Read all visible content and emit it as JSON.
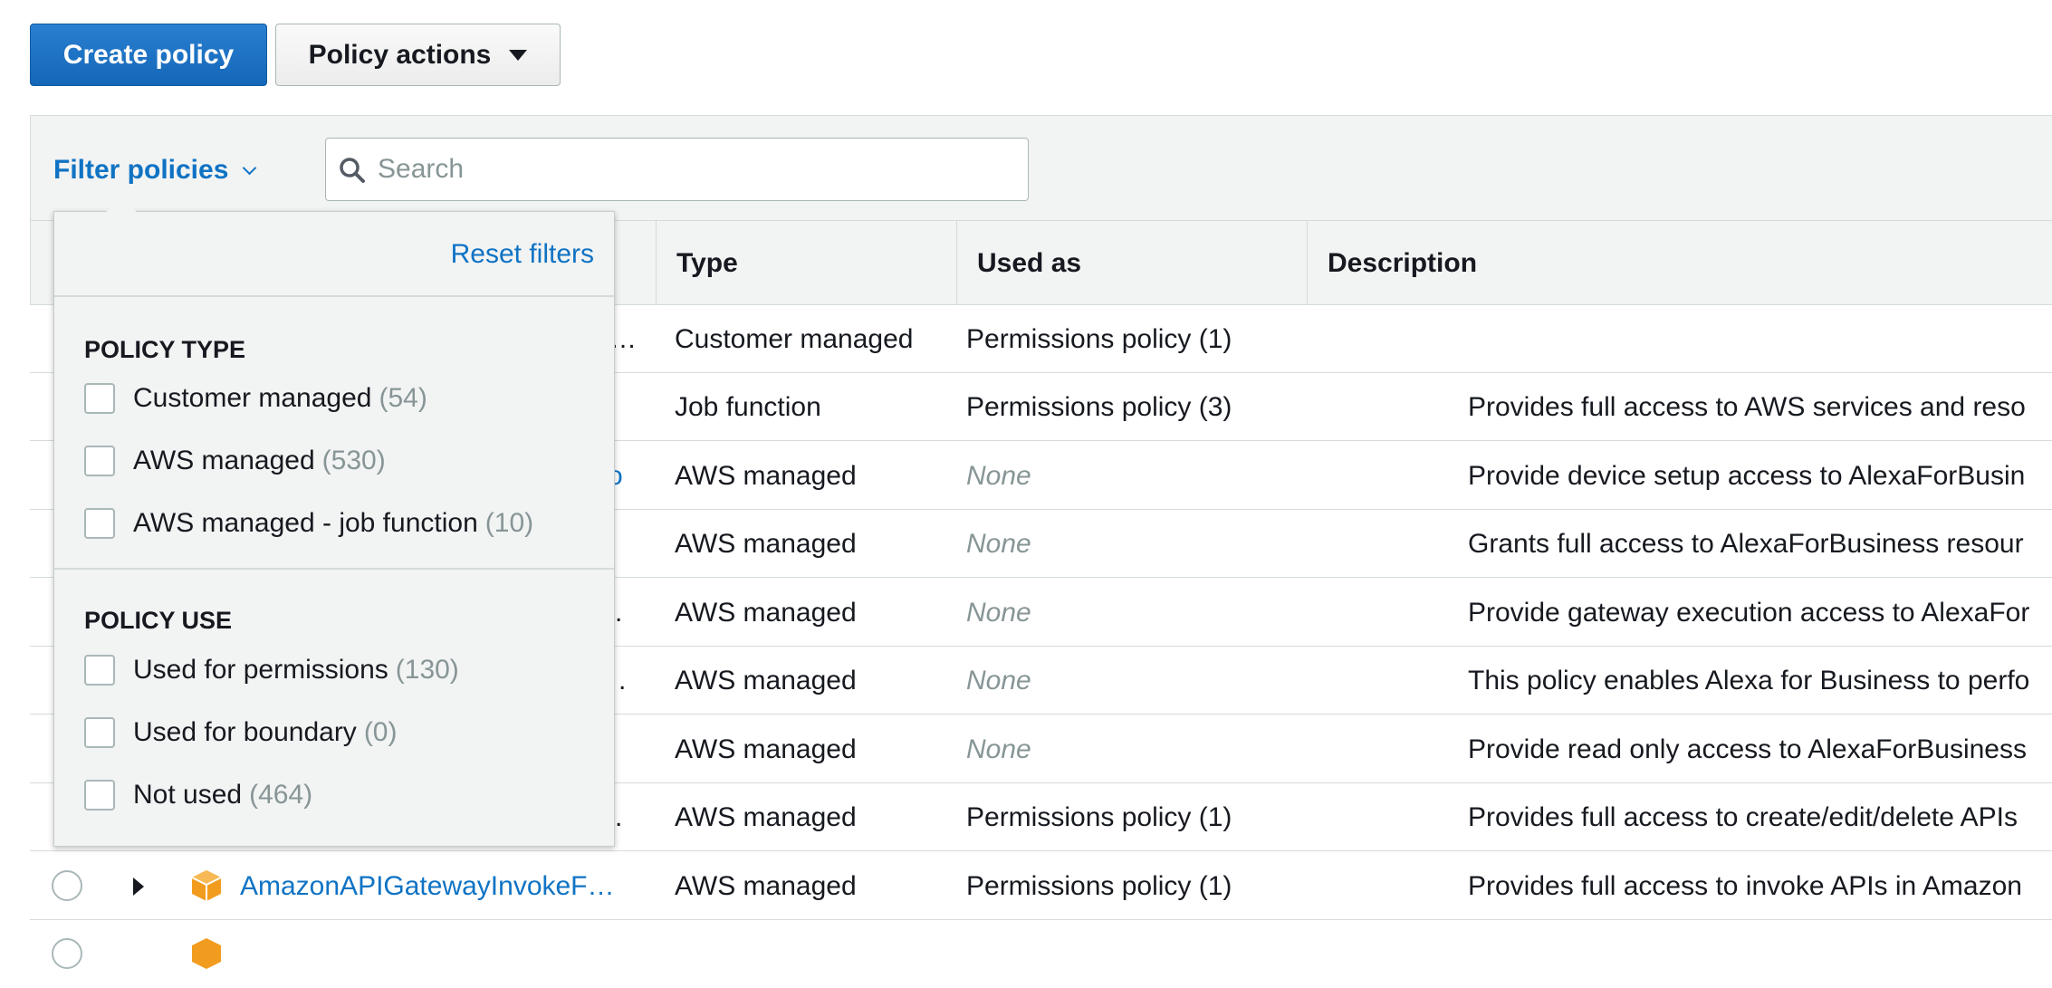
{
  "toolbar": {
    "create_label": "Create policy",
    "actions_label": "Policy actions"
  },
  "filter": {
    "toggle_label": "Filter policies",
    "search_placeholder": "Search"
  },
  "columns": [
    "Type",
    "Used as",
    "Description"
  ],
  "rows": [
    {
      "name_tail": "…",
      "type": "Customer managed",
      "used_as": "Permissions policy (1)",
      "used_none": false,
      "description": ""
    },
    {
      "name_tail": "",
      "type": "Job function",
      "used_as": "Permissions policy (3)",
      "used_none": false,
      "description": "Provides full access to AWS services and reso"
    },
    {
      "name_tail": "o",
      "type": "AWS managed",
      "used_as": "None",
      "used_none": true,
      "description": "Provide device setup access to AlexaForBusin"
    },
    {
      "name_tail": "",
      "type": "AWS managed",
      "used_as": "None",
      "used_none": true,
      "description": "Grants full access to AlexaForBusiness resour"
    },
    {
      "name_tail": ".",
      "type": "AWS managed",
      "used_as": "None",
      "used_none": true,
      "description": "Provide gateway execution access to AlexaFor"
    },
    {
      "name_tail": ".",
      "type": "AWS managed",
      "used_as": "None",
      "used_none": true,
      "description": "This policy enables Alexa for Business to perfo"
    },
    {
      "name_tail": "",
      "type": "AWS managed",
      "used_as": "None",
      "used_none": true,
      "description": "Provide read only access to AlexaForBusiness"
    },
    {
      "name_tail": ".",
      "type": "AWS managed",
      "used_as": "Permissions policy (1)",
      "used_none": false,
      "description": "Provides full access to create/edit/delete APIs"
    },
    {
      "name": "AmazonAPIGatewayInvokeF…",
      "type": "AWS managed",
      "used_as": "Permissions policy (1)",
      "used_none": false,
      "description": "Provides full access to invoke APIs in Amazon"
    }
  ],
  "dropdown": {
    "reset_label": "Reset filters",
    "policy_type_title": "POLICY TYPE",
    "policy_type_options": [
      {
        "label": "Customer managed",
        "count": "(54)"
      },
      {
        "label": "AWS managed",
        "count": "(530)"
      },
      {
        "label": "AWS managed - job function",
        "count": "(10)"
      }
    ],
    "policy_use_title": "POLICY USE",
    "policy_use_options": [
      {
        "label": "Used for permissions",
        "count": "(130)"
      },
      {
        "label": "Used for boundary",
        "count": "(0)"
      },
      {
        "label": "Not used",
        "count": "(464)"
      }
    ]
  },
  "colors": {
    "primary": "#1a70c4",
    "link": "#0f73c4",
    "muted": "#879596",
    "policy_icon": "#f29c1f"
  },
  "icons": {
    "search": "search-icon",
    "policy": "policy-cube-icon",
    "caret": "caret-down-icon",
    "chevron": "chevron-down-icon",
    "expand": "expand-triangle-icon"
  }
}
